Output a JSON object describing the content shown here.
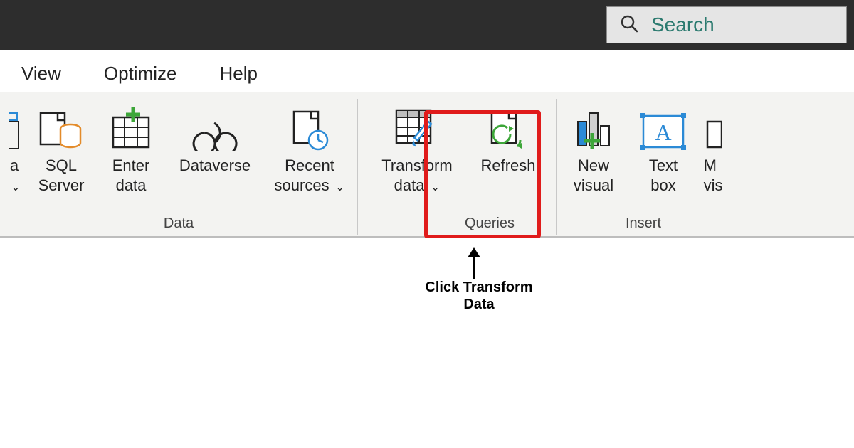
{
  "titlebar": {
    "search_label": "Search"
  },
  "menubar": {
    "view": "View",
    "optimize": "Optimize",
    "help": "Help"
  },
  "ribbon": {
    "data_label_partial": "a",
    "sql_server": "SQL\nServer",
    "enter_data": "Enter\ndata",
    "dataverse": "Dataverse",
    "recent_sources": "Recent\nsources",
    "transform_data": "Transform\ndata",
    "refresh": "Refresh",
    "new_visual": "New\nvisual",
    "text_box": "Text\nbox",
    "more_vis_partial": "M\nvis"
  },
  "groups": {
    "data": "Data",
    "queries": "Queries",
    "insert": "Insert"
  },
  "annotation": {
    "click_transform": "Click Transform\nData"
  }
}
